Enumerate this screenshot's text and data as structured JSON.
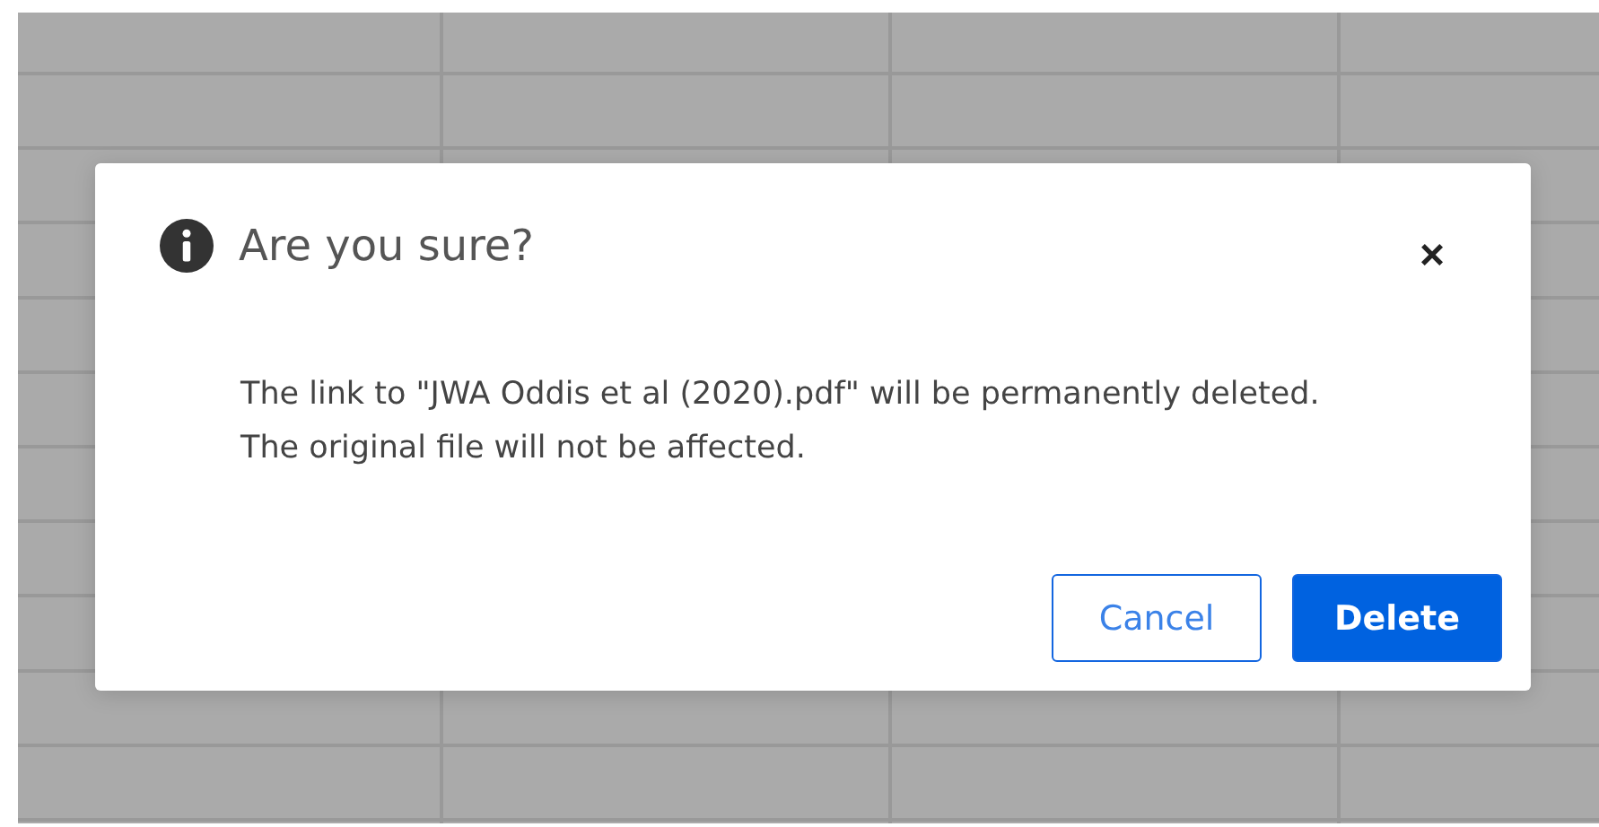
{
  "dialog": {
    "title": "Are you sure?",
    "close": "×",
    "message": "The link to \"JWA Oddis et al (2020).pdf\" will be permanently deleted. The original file will not be affected.",
    "buttons": [
      {
        "label": "Cancel",
        "kind": "secondary"
      },
      {
        "label": "Delete",
        "kind": "primary"
      }
    ]
  }
}
